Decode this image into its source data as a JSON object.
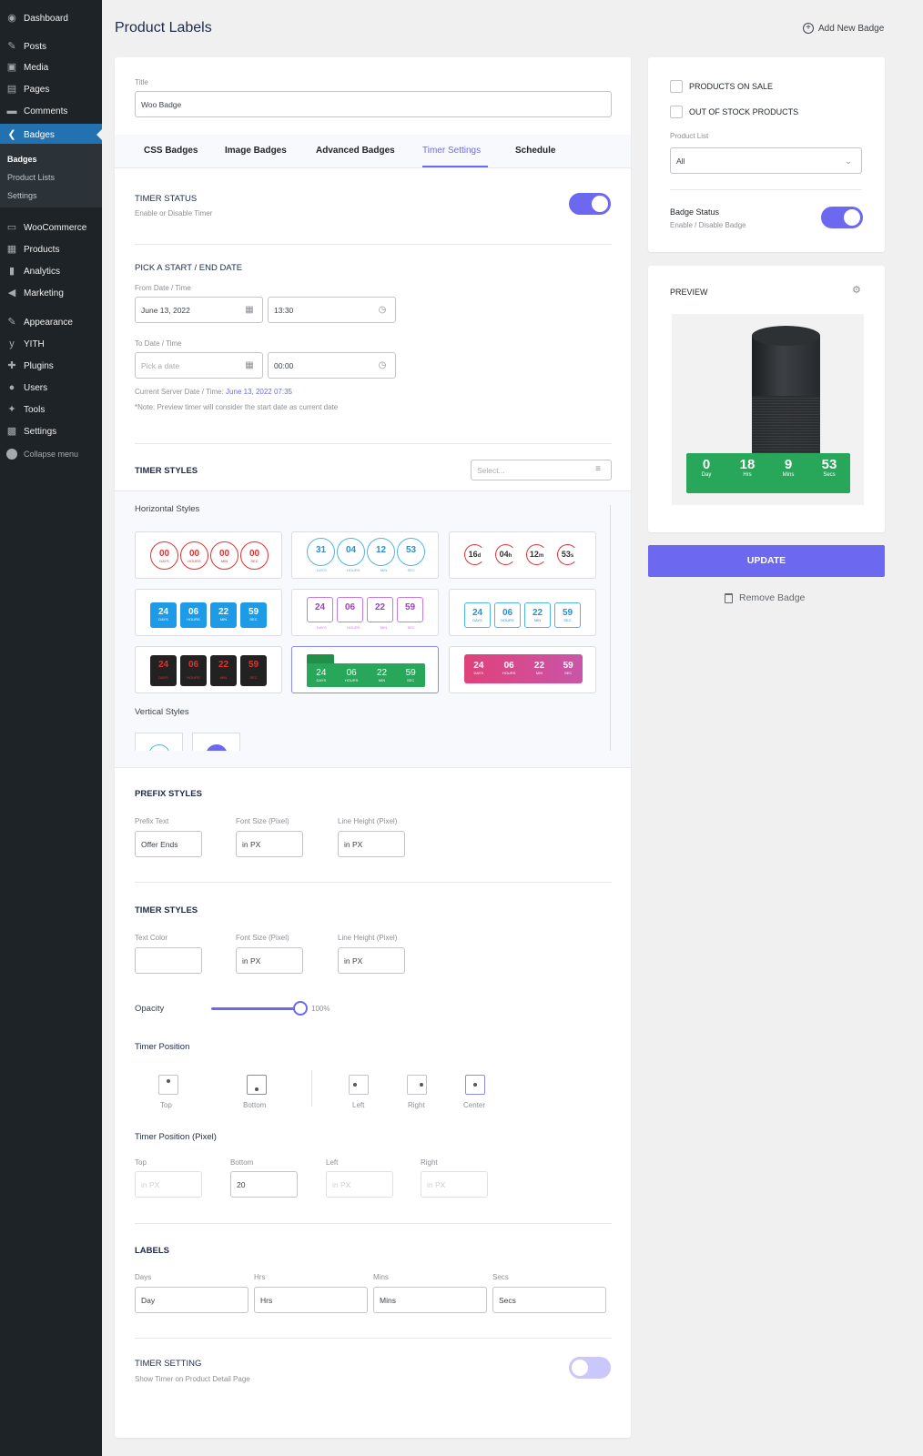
{
  "sidebar": {
    "items": [
      {
        "label": "Dashboard",
        "icon": "dashboard-icon"
      },
      {
        "label": "Posts",
        "icon": "pin-icon"
      },
      {
        "label": "Media",
        "icon": "media-icon"
      },
      {
        "label": "Pages",
        "icon": "pages-icon"
      },
      {
        "label": "Comments",
        "icon": "comments-icon"
      },
      {
        "label": "Badges",
        "icon": "badges-icon"
      },
      {
        "label": "WooCommerce",
        "icon": "woocommerce-icon"
      },
      {
        "label": "Products",
        "icon": "products-icon"
      },
      {
        "label": "Analytics",
        "icon": "analytics-icon"
      },
      {
        "label": "Marketing",
        "icon": "marketing-icon"
      },
      {
        "label": "Appearance",
        "icon": "appearance-icon"
      },
      {
        "label": "YITH",
        "icon": "yith-icon"
      },
      {
        "label": "Plugins",
        "icon": "plugins-icon"
      },
      {
        "label": "Users",
        "icon": "users-icon"
      },
      {
        "label": "Tools",
        "icon": "tools-icon"
      },
      {
        "label": "Settings",
        "icon": "settings-icon"
      }
    ],
    "submenu": [
      "Badges",
      "Product Lists",
      "Settings"
    ],
    "collapse": "Collapse menu"
  },
  "header": {
    "title": "Product Labels",
    "add_button": "Add New Badge"
  },
  "form": {
    "title_label": "Title",
    "title_value": "Woo Badge",
    "tabs": [
      "CSS Badges",
      "Image Badges",
      "Advanced Badges",
      "Timer Settings",
      "Schedule"
    ],
    "timer_status": {
      "title": "TIMER STATUS",
      "desc": "Enable or Disable Timer",
      "on": true
    },
    "dates": {
      "title": "PICK A START / END DATE",
      "from_label": "From Date / Time",
      "from_date": "June 13, 2022",
      "from_time": "13:30",
      "to_label": "To Date / Time",
      "to_date_placeholder": "Pick a date",
      "to_time": "00:00",
      "server_label": "Current Server Date / Time:",
      "server_value": "June 13, 2022 07:35",
      "note": "*Note: Preview timer will consider the start date as current date"
    },
    "timer_styles": {
      "title": "TIMER STYLES",
      "select_placeholder": "Select...",
      "horizontal_label": "Horizontal Styles",
      "vertical_label": "Vertical Styles",
      "style1": {
        "values": [
          "00",
          "00",
          "00",
          "00"
        ],
        "units": [
          "DAYS",
          "HOURS",
          "MIN",
          "SEC"
        ]
      },
      "style2": {
        "values": [
          "31",
          "04",
          "12",
          "53"
        ],
        "units": [
          "DAYS",
          "HOURS",
          "MIN",
          "SEC"
        ]
      },
      "style3": {
        "values": [
          "16",
          "04",
          "12",
          "53"
        ],
        "suffix": [
          "d",
          "h",
          "m",
          "s"
        ]
      },
      "style4": {
        "values": [
          "24",
          "06",
          "22",
          "59"
        ],
        "units": [
          "DAYS",
          "HOURS",
          "MIN",
          "SEC"
        ]
      },
      "style5": {
        "values": [
          "24",
          "06",
          "22",
          "59"
        ],
        "units": [
          "DAYS",
          "HOURS",
          "MIN",
          "SEC"
        ]
      },
      "style6": {
        "values": [
          "24",
          "06",
          "22",
          "59"
        ],
        "units": [
          "DAYS",
          "HOURS",
          "MIN",
          "SEC"
        ]
      },
      "style7": {
        "values": [
          "24",
          "06",
          "22",
          "59"
        ],
        "units": [
          "DAYS",
          "HOURS",
          "MIN",
          "SEC"
        ]
      },
      "style8": {
        "values": [
          "24",
          "06",
          "22",
          "59"
        ],
        "units": [
          "DAYS",
          "HOURS",
          "MIN",
          "SEC"
        ]
      },
      "style9": {
        "values": [
          "24",
          "06",
          "22",
          "59"
        ],
        "units": [
          "DAYS",
          "HOURS",
          "MIN",
          "SEC"
        ]
      }
    },
    "prefix": {
      "title": "PREFIX STYLES",
      "text_label": "Prefix Text",
      "text_value": "Offer Ends",
      "size_label": "Font Size (Pixel)",
      "size_placeholder": "in PX",
      "lh_label": "Line Height (Pixel)",
      "lh_placeholder": "in PX"
    },
    "timer_style2": {
      "title": "TIMER STYLES",
      "color_label": "Text Color",
      "size_label": "Font Size (Pixel)",
      "size_placeholder": "in PX",
      "lh_label": "Line Height (Pixel)",
      "lh_placeholder": "in PX",
      "opacity_label": "Opacity",
      "opacity_value": "100%",
      "opacity_fraction": 1.0
    },
    "position": {
      "title": "Timer Position",
      "options": [
        "Top",
        "Bottom",
        "Left",
        "Right",
        "Center"
      ],
      "selected": "Bottom"
    },
    "position_px": {
      "title": "Timer Position (Pixel)",
      "labels": [
        "Top",
        "Bottom",
        "Left",
        "Right"
      ],
      "placeholder": "in PX",
      "bottom_value": "20"
    },
    "labels": {
      "title": "LABELS",
      "fields": [
        {
          "label": "Days",
          "value": "Day"
        },
        {
          "label": "Hrs",
          "value": "Hrs"
        },
        {
          "label": "Mins",
          "value": "Mins"
        },
        {
          "label": "Secs",
          "value": "Secs"
        }
      ]
    },
    "timer_setting": {
      "title": "TIMER SETTING",
      "desc": "Show Timer on Product Detail Page",
      "on": false
    }
  },
  "side": {
    "on_sale": "PRODUCTS ON SALE",
    "out_of_stock": "OUT OF STOCK PRODUCTS",
    "product_list_label": "Product List",
    "product_list_value": "All",
    "badge_status_title": "Badge Status",
    "badge_status_desc": "Enable / Disable Badge",
    "preview_title": "PREVIEW",
    "preview_timer": {
      "values": [
        "0",
        "18",
        "9",
        "53"
      ],
      "units": [
        "Day",
        "Hrs",
        "Mins",
        "Secs"
      ]
    },
    "update": "UPDATE",
    "remove": "Remove Badge"
  },
  "colors": {
    "accent": "#6c68f0",
    "sidebar": "#1d2327",
    "active_nav": "#2271b1",
    "preview_green": "#28a65a"
  }
}
